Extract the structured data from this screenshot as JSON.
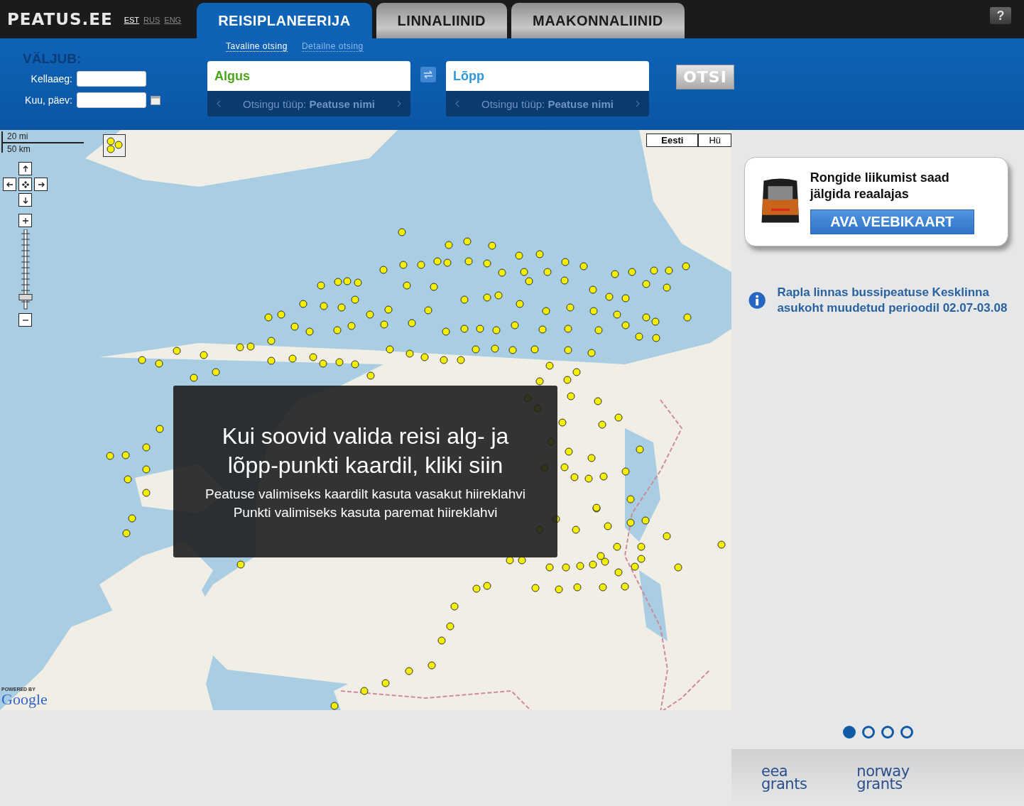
{
  "header": {
    "logo": "PEATUS.EE",
    "languages": [
      {
        "label": "EST",
        "selected": true
      },
      {
        "label": "RUS",
        "selected": false
      },
      {
        "label": "ENG",
        "selected": false
      }
    ],
    "tabs": [
      {
        "label": "REISIPLANEERIJA",
        "selected": true
      },
      {
        "label": "LINNALIINID",
        "selected": false
      },
      {
        "label": "MAAKONNALIINID",
        "selected": false
      }
    ],
    "help": "?"
  },
  "search": {
    "modes": [
      {
        "label": "Tavaline otsing",
        "selected": true
      },
      {
        "label": "Detailne otsing",
        "selected": false
      }
    ],
    "departure": {
      "title": "VÄLJUB:",
      "time_label": "Kellaaeg:",
      "date_label": "Kuu, päev:"
    },
    "from": {
      "placeholder": "Algus",
      "type_label": "Otsingu tüüp:",
      "type_value": "Peatuse nimi"
    },
    "to": {
      "placeholder": "Lõpp",
      "type_label": "Otsingu tüüp:",
      "type_value": "Peatuse nimi"
    },
    "button": "OTSI"
  },
  "map": {
    "scale": [
      "20 mi",
      "50 km"
    ],
    "zoom": {
      "level": 0.12
    },
    "layers": [
      {
        "label": "Eesti",
        "selected": true
      },
      {
        "label": "Hü",
        "selected": false
      }
    ],
    "overlay": {
      "title": "Kui soovid valida reisi alg- ja lõpp-punkti kaardil, kliki siin",
      "lines": [
        "Peatuse valimiseks kaardilt kasuta vasakut hiireklahvi",
        "Punkti valimiseks kasuta paremat hiireklahvi"
      ]
    },
    "attribution": {
      "small": "POWERED BY",
      "brand": "Google"
    }
  },
  "sidebar": {
    "promo": {
      "text": "Rongide liikumist saad jälgida reaalajas",
      "button": "AVA VEEBIKAART"
    },
    "notice": "Rapla linnas bussipeatuse Kesklinna asukoht muudetud perioodil 02.07-03.08",
    "pager": [
      {
        "selected": true
      },
      {
        "selected": false
      },
      {
        "selected": false
      },
      {
        "selected": false
      }
    ],
    "logos": [
      {
        "top": "eea",
        "bottom": "grants"
      },
      {
        "top": "norway",
        "bottom": "grants"
      }
    ]
  }
}
